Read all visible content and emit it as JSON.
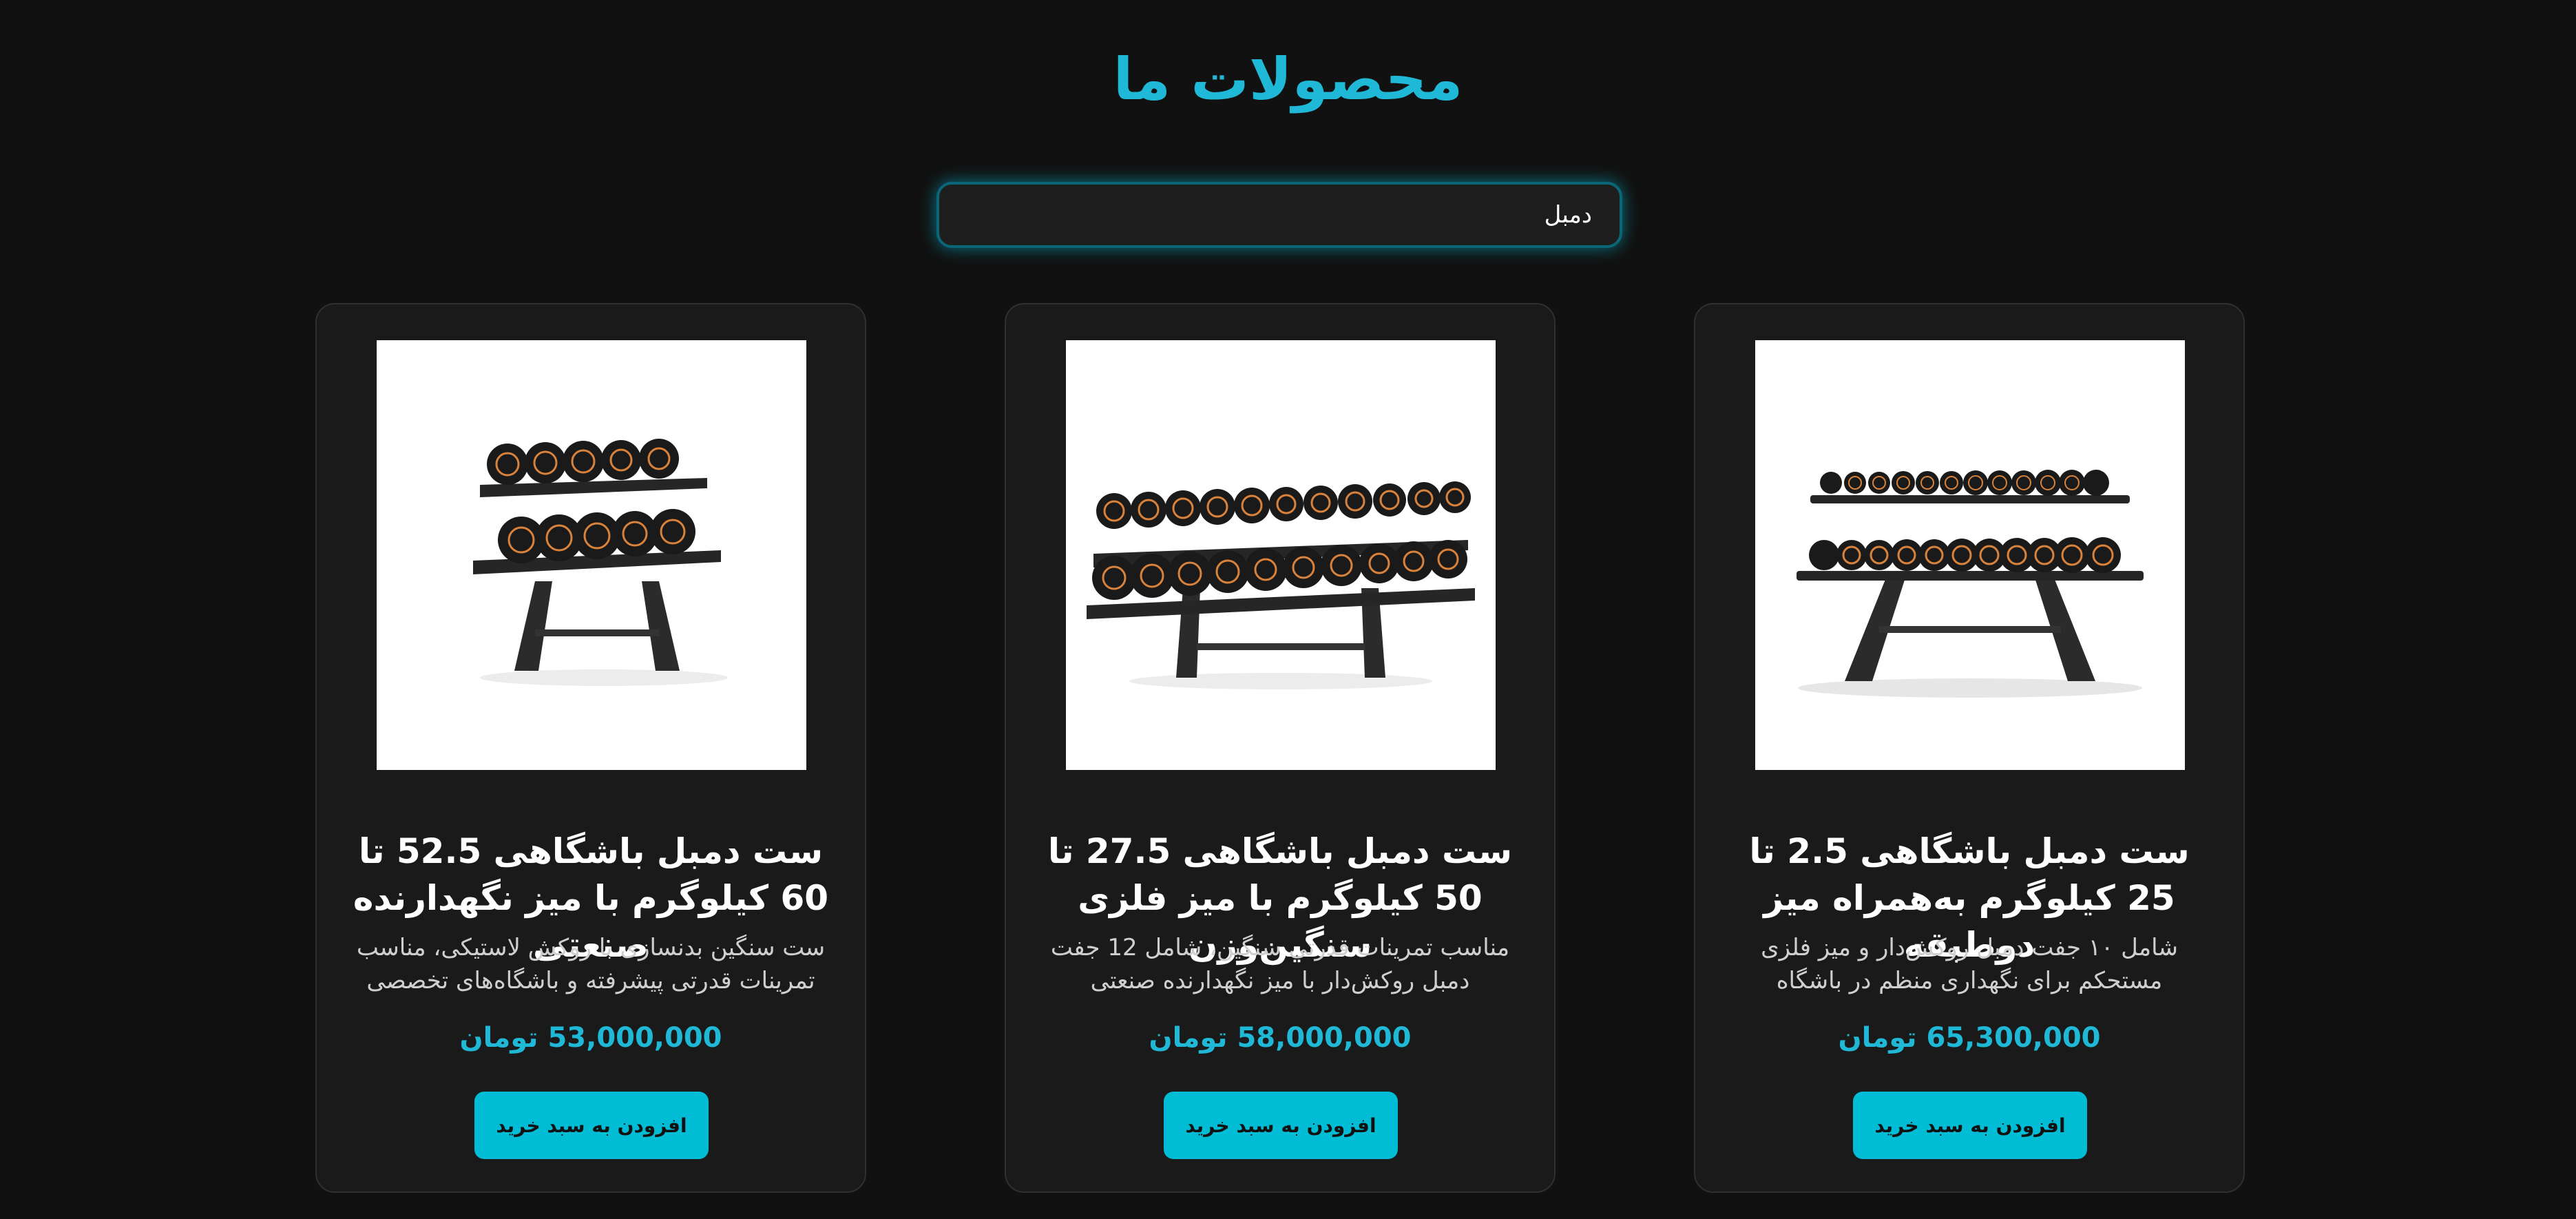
{
  "page": {
    "title": "محصولات ما"
  },
  "search": {
    "value": "دمبل"
  },
  "colors": {
    "background": "#111111",
    "card_background": "#1a1a1a",
    "accent": "#1fb8d6",
    "button": "#00bcd4"
  },
  "products": [
    {
      "title": "ست دمبل باشگاهی 2.5 تا 25 کیلوگرم به‌همراه میز دوطبقه",
      "description": "شامل ۱۰ جفت دمبل روکش‌دار و میز فلزی مستحکم برای نگهداری منظم در باشگاه",
      "price": "65,300,000 تومان",
      "button_label": "افزودن به سبد خرید",
      "image_icon": "dumbbell-rack-icon"
    },
    {
      "title": "ست دمبل باشگاهی 27.5 تا 50 کیلوگرم با میز فلزی سنگین‌وزن",
      "description": "مناسب تمرینات قدرتی سنگین، شامل 12 جفت دمبل روکش‌دار با میز نگهدارنده صنعتی",
      "price": "58,000,000 تومان",
      "button_label": "افزودن به سبد خرید",
      "image_icon": "dumbbell-rack-icon"
    },
    {
      "title": "ست دمبل باشگاهی 52.5 تا 60 کیلوگرم با میز نگهدارنده صنعتی",
      "description": "ست سنگین بدنسازی با روکش لاستیکی، مناسب تمرینات قدرتی پیشرفته و باشگاه‌های تخصصی",
      "price": "53,000,000 تومان",
      "button_label": "افزودن به سبد خرید",
      "image_icon": "dumbbell-rack-icon"
    }
  ]
}
